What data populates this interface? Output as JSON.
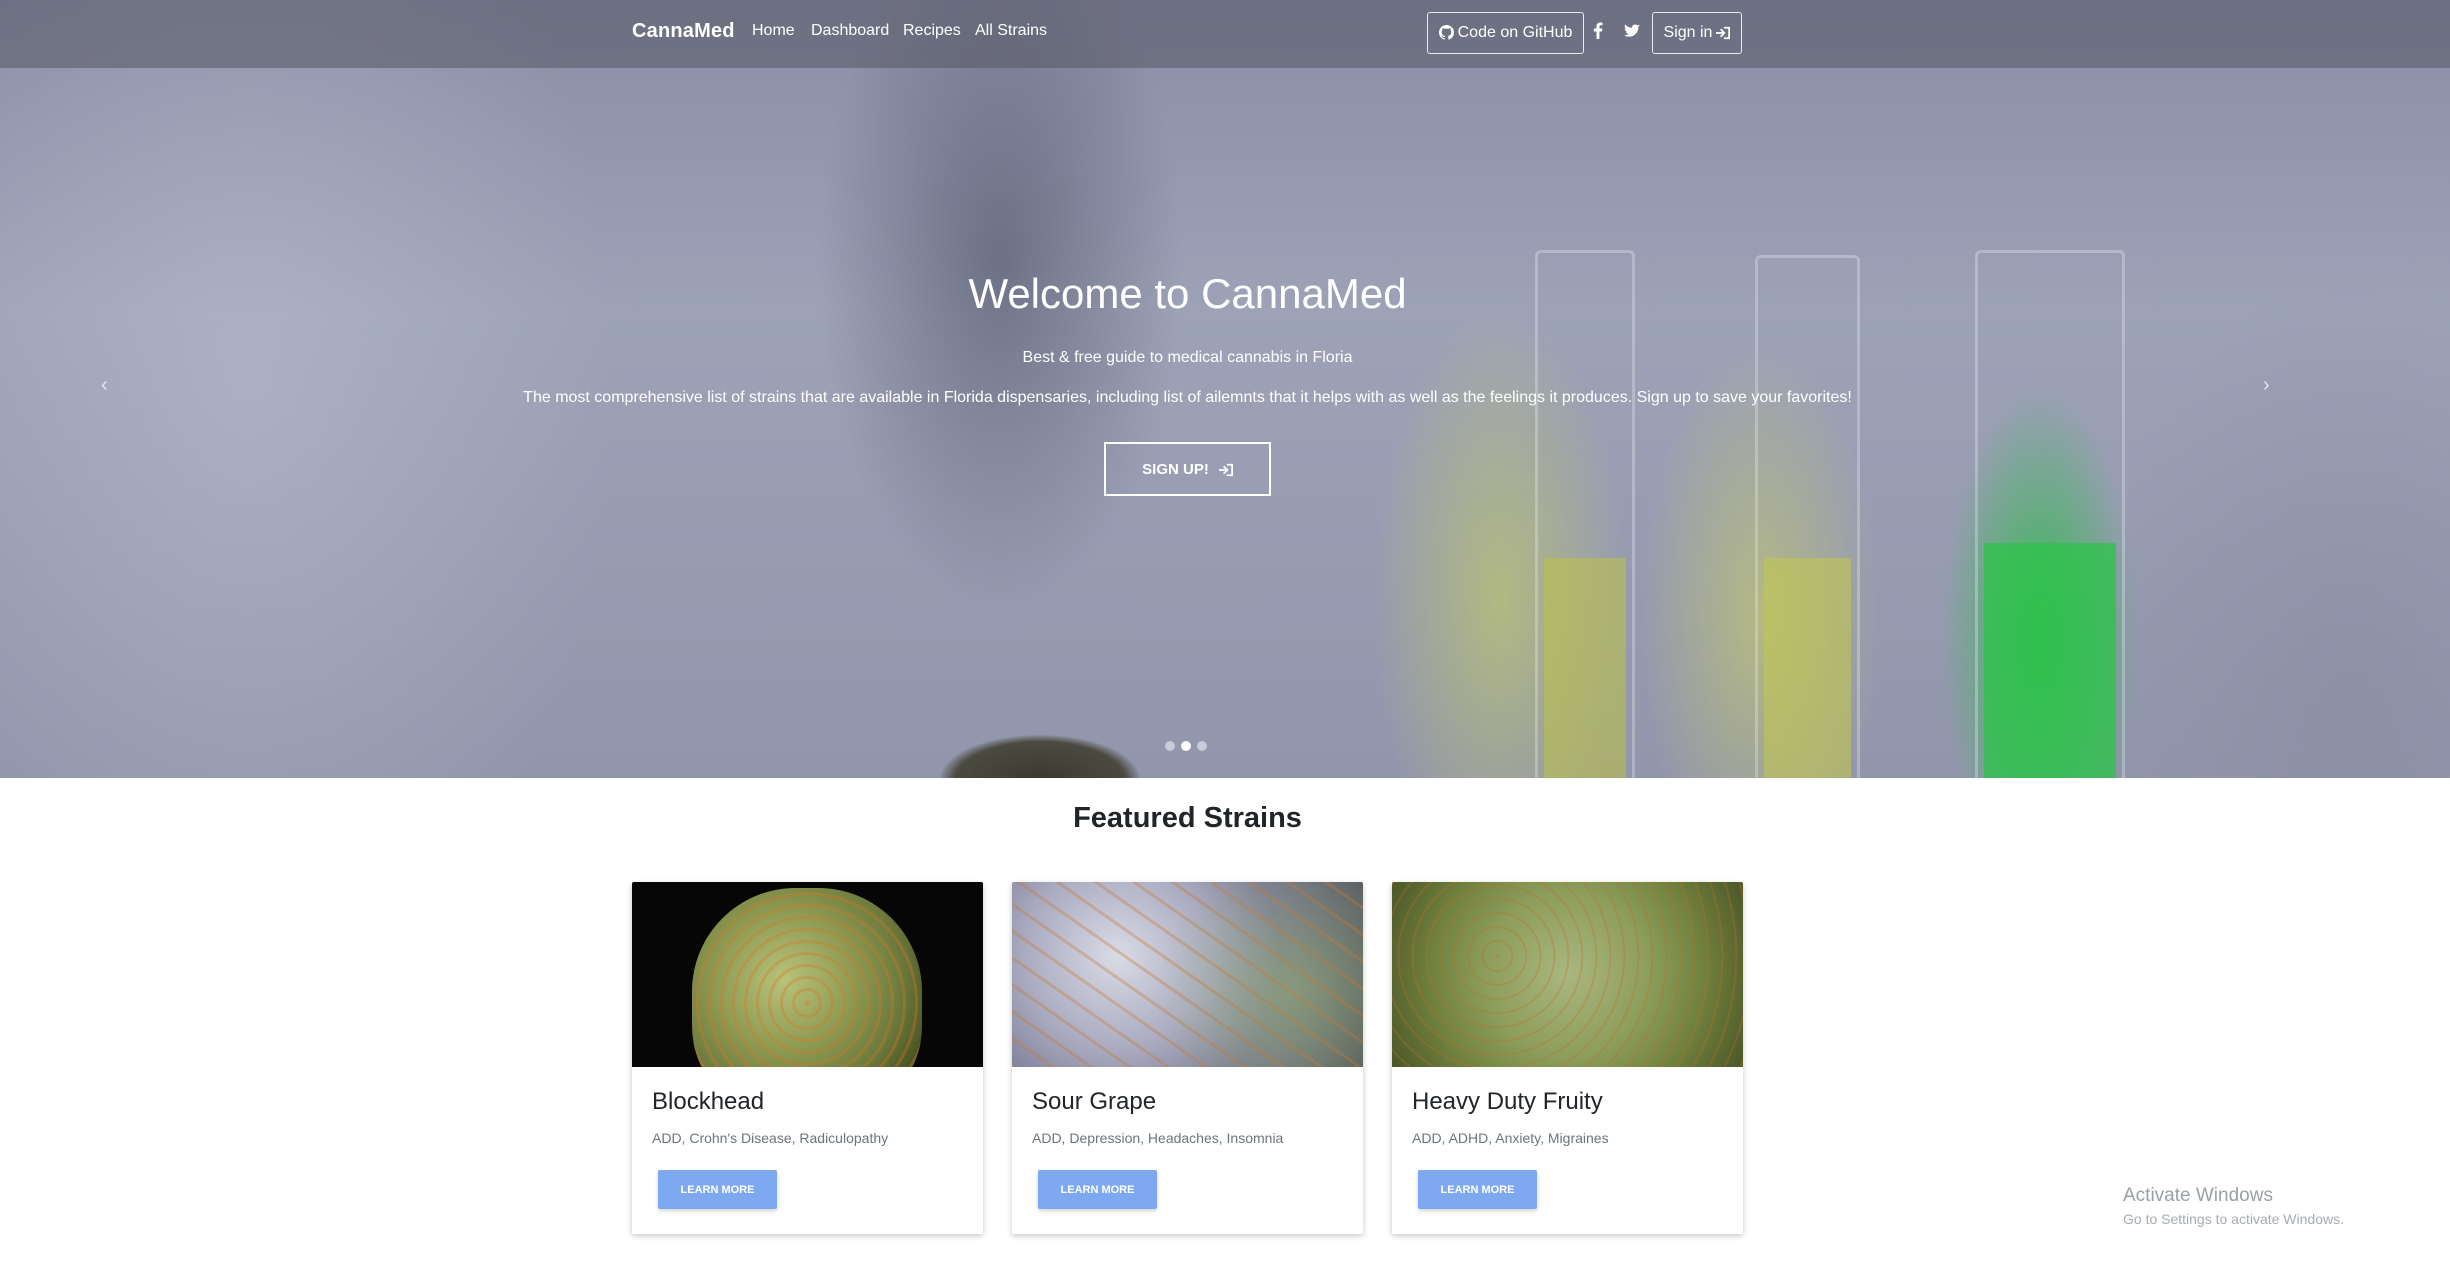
{
  "navbar": {
    "brand": "CannaMed",
    "links": [
      "Home",
      "Dashboard",
      "Recipes",
      "All Strains"
    ],
    "github_label": "Code on GitHub",
    "signin_label": "Sign in",
    "icons": [
      "github-icon",
      "facebook-icon",
      "twitter-icon",
      "sign-in-icon"
    ]
  },
  "hero": {
    "title": "Welcome to CannaMed",
    "subtitle": "Best & free guide to medical cannabis in Floria",
    "description": "The most comprehensive list of strains that are available in Florida dispensaries, including list of ailemnts that it helps with as well as the feelings it produces. Sign up to save your favorites!",
    "signup_label": "SIGN UP!",
    "prev_glyph": "‹",
    "next_glyph": "›",
    "slide_count": 3,
    "active_slide": 2
  },
  "featured": {
    "heading": "Featured Strains",
    "button_label": "LEARN MORE",
    "cards": [
      {
        "name": "Blockhead",
        "tags": "ADD, Crohn's Disease, Radiculopathy"
      },
      {
        "name": "Sour Grape",
        "tags": "ADD, Depression, Headaches, Insomnia"
      },
      {
        "name": "Heavy Duty Fruity",
        "tags": "ADD, ADHD, Anxiety, Migraines"
      }
    ]
  },
  "watermark": {
    "line1": "Activate Windows",
    "line2": "Go to Settings to activate Windows."
  },
  "colors": {
    "accent_button": "#7ea8f0",
    "navbar_bg": "rgba(85,87,100,0.55)"
  }
}
